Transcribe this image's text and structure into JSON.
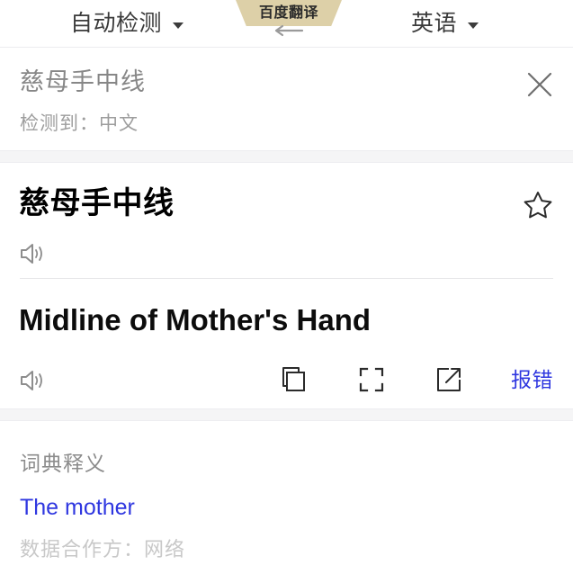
{
  "header": {
    "source_language": "自动检测",
    "target_language": "英语",
    "brand_badge": "百度翻译",
    "swap_icon": "swap-languages-icon",
    "source_caret_icon": "chevron-down-icon",
    "target_caret_icon": "chevron-down-icon"
  },
  "input": {
    "text": "慈母手中线",
    "placeholder": "慈母手中线",
    "detected_label": "检测到：中文",
    "clear_icon": "close-icon"
  },
  "result": {
    "source_text": "慈母手中线",
    "target_text": "Midline of Mother's Hand",
    "favorite_icon": "star-outline-icon",
    "source_speaker_icon": "speaker-icon",
    "target_speaker_icon": "speaker-icon",
    "actions": {
      "copy_icon": "copy-icon",
      "fullscreen_icon": "fullscreen-icon",
      "share_icon": "share-external-link-icon",
      "report_label": "报错"
    }
  },
  "dictionary": {
    "title": "词典释义",
    "entry": "The mother",
    "source_note": "数据合作方：网络"
  },
  "colors": {
    "accent_blue": "#2f37e0",
    "badge_beige": "#ddd0a8",
    "separator_gray": "#f5f5f6",
    "muted_text": "#9d9d9d"
  }
}
